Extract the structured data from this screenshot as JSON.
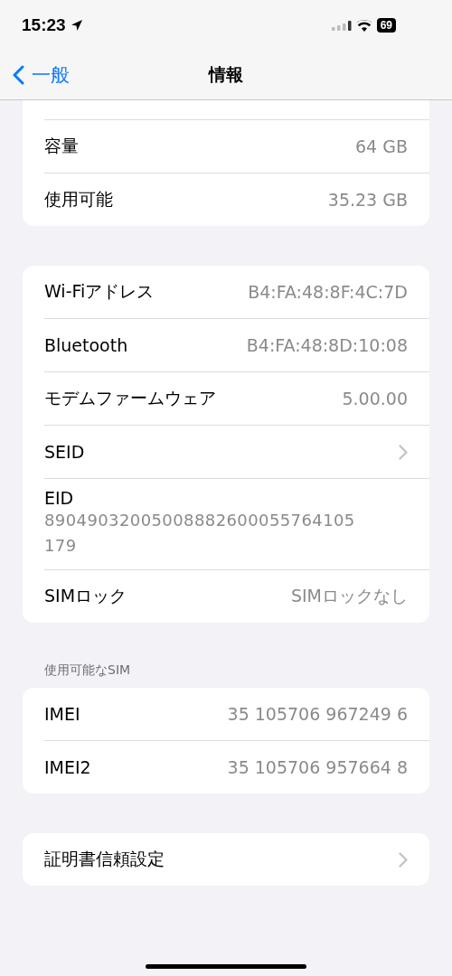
{
  "status_bar": {
    "time": "15:23",
    "battery": "69"
  },
  "nav": {
    "back": "一般",
    "title": "情報"
  },
  "sections": [
    {
      "clipped_top": true,
      "rows": [
        {
          "kind": "value",
          "label": "容量",
          "value": "64 GB"
        },
        {
          "kind": "value",
          "label": "使用可能",
          "value": "35.23 GB"
        }
      ]
    },
    {
      "rows": [
        {
          "kind": "value",
          "label": "Wi-Fiアドレス",
          "value": "B4:FA:48:8F:4C:7D"
        },
        {
          "kind": "value",
          "label": "Bluetooth",
          "value": "B4:FA:48:8D:10:08"
        },
        {
          "kind": "value",
          "label": "モデムファームウェア",
          "value": "5.00.00"
        },
        {
          "kind": "chevron",
          "label": "SEID"
        },
        {
          "kind": "stacked",
          "label": "EID",
          "value": "89049032005008882600055764105",
          "value_2": "179"
        },
        {
          "kind": "value",
          "label": "SIMロック",
          "value": "SIMロックなし"
        }
      ]
    },
    {
      "header": "使用可能なSIM",
      "rows": [
        {
          "kind": "value",
          "label": "IMEI",
          "value": "35 105706 967249 6"
        },
        {
          "kind": "value",
          "label": "IMEI2",
          "value": "35 105706 957664 8"
        }
      ]
    },
    {
      "rows": [
        {
          "kind": "chevron",
          "label": "証明書信頼設定"
        }
      ]
    }
  ]
}
